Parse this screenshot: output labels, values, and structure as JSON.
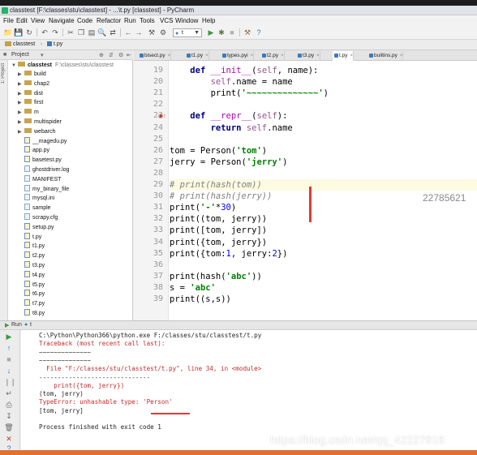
{
  "window": {
    "title": "classtest [F:\\classes\\stu\\classtest] - ...\\t.py [classtest] - PyCharm",
    "accent": "#e3702f"
  },
  "menu": [
    "File",
    "Edit",
    "View",
    "Navigate",
    "Code",
    "Refactor",
    "Run",
    "Tools",
    "VCS",
    "Window",
    "Help"
  ],
  "toolbar": {
    "run_config": "t"
  },
  "navbar": {
    "crumbs": [
      "classtest",
      "t.py"
    ]
  },
  "project": {
    "header": "Project",
    "root_name": "classtest",
    "root_path": "F:\\classes\\stu\\classtest",
    "items": [
      {
        "label": "build",
        "kind": "folder"
      },
      {
        "label": "chap2",
        "kind": "folder"
      },
      {
        "label": "dist",
        "kind": "folder"
      },
      {
        "label": "first",
        "kind": "folder"
      },
      {
        "label": "m",
        "kind": "folder"
      },
      {
        "label": "multispider",
        "kind": "folder"
      },
      {
        "label": "webarch",
        "kind": "folder"
      },
      {
        "label": "__magedu.py",
        "kind": "py"
      },
      {
        "label": "app.py",
        "kind": "py"
      },
      {
        "label": "basetest.py",
        "kind": "py"
      },
      {
        "label": "ghostdriver.log",
        "kind": "file"
      },
      {
        "label": "MANIFEST",
        "kind": "file"
      },
      {
        "label": "my_binary_file",
        "kind": "file"
      },
      {
        "label": "mysql.ini",
        "kind": "file"
      },
      {
        "label": "sample",
        "kind": "file"
      },
      {
        "label": "scrapy.cfg",
        "kind": "file"
      },
      {
        "label": "setup.py",
        "kind": "py"
      },
      {
        "label": "t.py",
        "kind": "py"
      },
      {
        "label": "t1.py",
        "kind": "py"
      },
      {
        "label": "t2.py",
        "kind": "py"
      },
      {
        "label": "t3.py",
        "kind": "py"
      },
      {
        "label": "t4.py",
        "kind": "py"
      },
      {
        "label": "t5.py",
        "kind": "py"
      },
      {
        "label": "t6.py",
        "kind": "py"
      },
      {
        "label": "t7.py",
        "kind": "py"
      },
      {
        "label": "t8.py",
        "kind": "py"
      }
    ]
  },
  "tabs": [
    "bisect.py",
    "t1.py",
    "types.pyi",
    "t2.py",
    "t3.py",
    "t.py",
    "builtins.py"
  ],
  "editor": {
    "lines": [
      {
        "n": "19",
        "text": "    def __init__(self, name):"
      },
      {
        "n": "20",
        "text": "        self.name = name"
      },
      {
        "n": "21",
        "text": "        print('~~~~~~~~~~~~~~')"
      },
      {
        "n": "22",
        "text": ""
      },
      {
        "n": "23",
        "text": "    def __repr__(self):"
      },
      {
        "n": "24",
        "text": "        return self.name"
      },
      {
        "n": "25",
        "text": ""
      },
      {
        "n": "26",
        "text": "tom = Person('tom')"
      },
      {
        "n": "27",
        "text": "jerry = Person('jerry')"
      },
      {
        "n": "28",
        "text": ""
      },
      {
        "n": "29",
        "text": "# print(hash(tom))"
      },
      {
        "n": "30",
        "text": "# print(hash(jerry))"
      },
      {
        "n": "31",
        "text": "print('-'*30)"
      },
      {
        "n": "32",
        "text": "print((tom, jerry))"
      },
      {
        "n": "33",
        "text": "print([tom, jerry])"
      },
      {
        "n": "34",
        "text": "print({tom, jerry})"
      },
      {
        "n": "35",
        "text": "print({tom:1, jerry:2})"
      },
      {
        "n": "36",
        "text": ""
      },
      {
        "n": "37",
        "text": "print(hash('abc'))"
      },
      {
        "n": "38",
        "text": "s = 'abc'"
      },
      {
        "n": "39",
        "text": "print((s,s))"
      }
    ],
    "ghost_text": "22785621"
  },
  "run": {
    "tab_label": "Run",
    "config": "t",
    "console": [
      {
        "text": "C:\\Python\\Python366\\python.exe F:/classes/stu/classtest/t.py",
        "err": false
      },
      {
        "text": "Traceback (most recent call last):",
        "err": true
      },
      {
        "text": "~~~~~~~~~~~~~~",
        "err": false
      },
      {
        "text": "~~~~~~~~~~~~~~",
        "err": false
      },
      {
        "text": "  File \"F:/classes/stu/classtest/t.py\", line 34, in <module>",
        "err": true
      },
      {
        "text": "------------------------------",
        "err": false
      },
      {
        "text": "    print({tom, jerry})",
        "err": true
      },
      {
        "text": "(tom, jerry)",
        "err": false
      },
      {
        "text": "TypeError: unhashable type: 'Person'",
        "err": true
      },
      {
        "text": "[tom, jerry]",
        "err": false
      },
      {
        "text": "",
        "err": false
      },
      {
        "text": "Process finished with exit code 1",
        "err": false
      }
    ]
  },
  "watermark": "https://blog.csdn.net/qq_42227818"
}
